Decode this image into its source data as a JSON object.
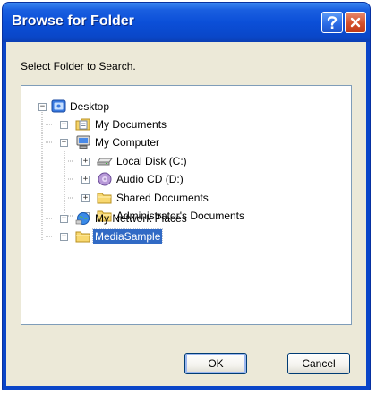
{
  "window": {
    "title": "Browse for Folder"
  },
  "titlebar_buttons": {
    "help": "?",
    "close": "✕"
  },
  "prompt": "Select Folder to Search.",
  "tree": {
    "nodes": [
      {
        "label": "Desktop",
        "icon": "desktop-icon",
        "expander": "−",
        "selected": false
      },
      {
        "label": "My Documents",
        "icon": "my-documents-icon",
        "expander": "+",
        "selected": false
      },
      {
        "label": "My Computer",
        "icon": "my-computer-icon",
        "expander": "−",
        "selected": false
      },
      {
        "label": "Local Disk (C:)",
        "icon": "hard-disk-icon",
        "expander": "+",
        "selected": false
      },
      {
        "label": "Audio CD (D:)",
        "icon": "cd-drive-icon",
        "expander": "+",
        "selected": false
      },
      {
        "label": "Shared Documents",
        "icon": "folder-icon",
        "expander": "+",
        "selected": false
      },
      {
        "label": "Administrator's Documents",
        "icon": "folder-icon",
        "expander": "+",
        "selected": false
      },
      {
        "label": "My Network Places",
        "icon": "network-places-icon",
        "expander": "+",
        "selected": false
      },
      {
        "label": "MediaSample",
        "icon": "folder-icon",
        "expander": "+",
        "selected": true
      }
    ]
  },
  "buttons": {
    "ok": "OK",
    "cancel": "Cancel"
  },
  "colors": {
    "titlebar": "#0b4fd8",
    "dialog_face": "#ece9d8",
    "selection": "#316ac5",
    "tree_border": "#7f9db9"
  }
}
